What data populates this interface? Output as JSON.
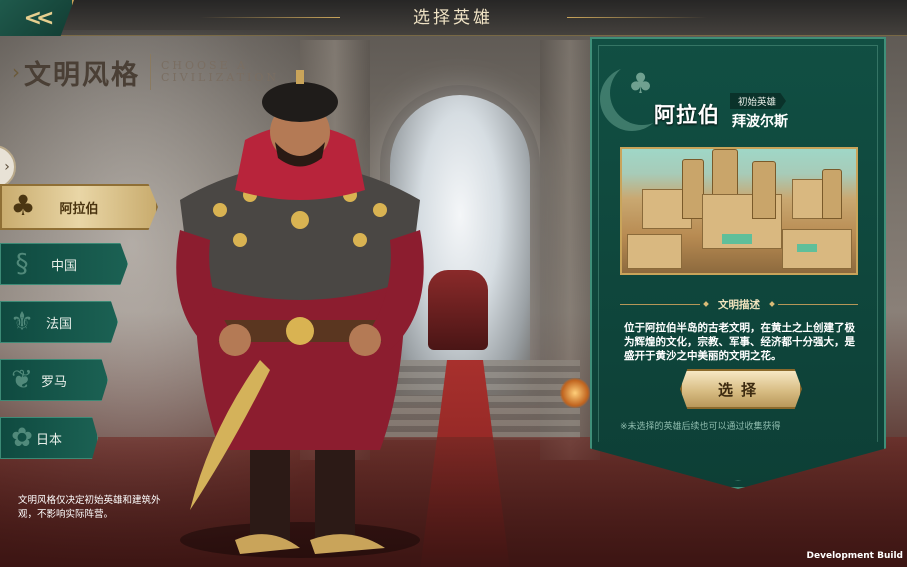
{
  "topbar": {
    "title": "选择英雄",
    "back_icon": "double-chevron-left-icon"
  },
  "section": {
    "title_cn": "文明风格",
    "title_en": "CHOOSE A CIVILIZATION"
  },
  "civilizations": [
    {
      "label": "阿拉伯",
      "icon": "palm-tree-icon",
      "selected": true
    },
    {
      "label": "中国",
      "icon": "dragon-icon",
      "selected": false
    },
    {
      "label": "法国",
      "icon": "fleur-de-lis-icon",
      "selected": false
    },
    {
      "label": "罗马",
      "icon": "laurel-wreath-icon",
      "selected": false
    },
    {
      "label": "日本",
      "icon": "sakura-icon",
      "selected": false
    }
  ],
  "civ_note": "文明风格仅决定初始英雄和建筑外观，不影响实际阵营。",
  "panel": {
    "civ_name": "阿拉伯",
    "hero_tag": "初始英雄",
    "hero_name": "拜波尔斯",
    "desc_title": "文明描述",
    "desc_text": "位于阿拉伯半岛的古老文明，在黄土之上创建了极为辉煌的文化，宗教、军事、经济都十分强大，是盛开于黄沙之中美丽的文明之花。",
    "select_label": "选择",
    "hint": "※未选择的英雄后续也可以通过收集获得",
    "accent_color": "#114f43",
    "gold_color": "#c9a45a"
  },
  "footer": {
    "dev_build": "Development Build"
  }
}
